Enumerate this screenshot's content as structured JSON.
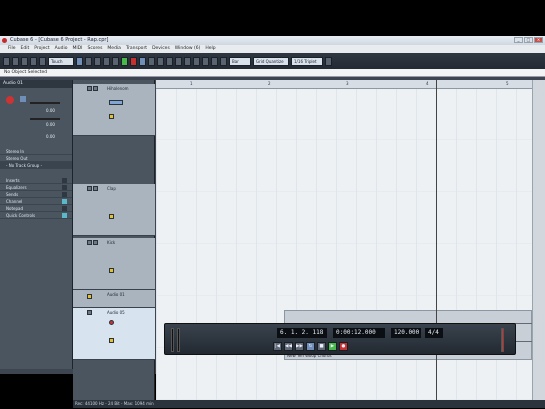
{
  "window": {
    "title": "Cubase 6 - [Cubase 6 Project - Rap.cpr]",
    "controls": [
      "_",
      "□",
      "×"
    ]
  },
  "menu": [
    "File",
    "Edit",
    "Project",
    "Audio",
    "MIDI",
    "Scores",
    "Media",
    "Transport",
    "Devices",
    "Window (6)",
    "Help"
  ],
  "toolbar": {
    "mode": "Touch",
    "grid_type": "Grid Quantize",
    "quantize": "1/16 Triplet",
    "bar": "Bar"
  },
  "info_line": "No Object Selected",
  "inspector": {
    "track_name": "Audio 01",
    "values": [
      "0.00",
      "0.00",
      "0.00"
    ],
    "routing": [
      "Stereo In",
      "Stereo Out",
      "- No Track Group -"
    ],
    "sections": [
      "Inserts",
      "Equalizers",
      "Sends",
      "Channel",
      "Notepad",
      "Quick Controls"
    ]
  },
  "tracks": [
    {
      "name": "Hihalenom"
    },
    {
      "name": "Clap"
    },
    {
      "name": "Kick"
    },
    {
      "name": "Audio 01"
    },
    {
      "name": "Audio 05"
    }
  ],
  "ruler": [
    "1",
    "2",
    "3",
    "4",
    "5"
  ],
  "event": {
    "label": "New Yeh Woop Chorus"
  },
  "transport": {
    "position": "6. 1. 2. 118",
    "time": "0:00:12.000",
    "tempo": "120.000",
    "signature": "4/4",
    "buttons": [
      "|◀",
      "◀◀",
      "▶▶",
      "↻",
      "■",
      "▶",
      "●"
    ]
  },
  "status": "Rec: 44100 Hz - 24 Bit - Max: 1094 min"
}
